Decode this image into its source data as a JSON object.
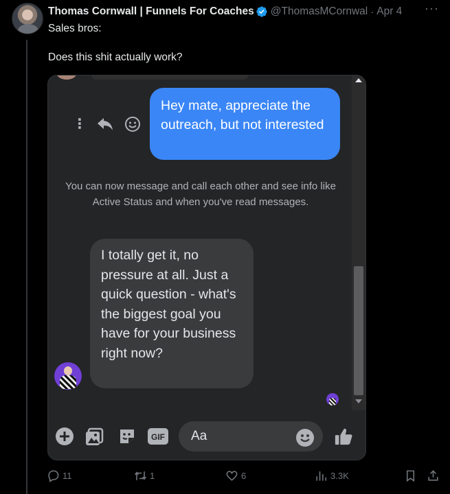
{
  "tweet": {
    "author_name": "Thomas Cornwall | Funnels For Coaches",
    "handle": "@ThomasMCornwal",
    "separator": "·",
    "date": "Apr 4",
    "more_label": "···",
    "text_line1": "Sales bros:",
    "text_line2": "Does this shit actually work?"
  },
  "chat": {
    "outgoing_message": "Hey mate, appreciate the outreach, but not interested",
    "system_notice": "You can now message and call each other and see info like Active Status and when you've read messages.",
    "incoming_message": "I totally get it, no pressure at all. Just a quick question - what's the biggest goal you have for your business right now?",
    "action_dots": "⋮",
    "composer": {
      "placeholder": "Aa",
      "gif_label": "GIF"
    },
    "colors": {
      "outgoing_bubble": "#3a86f6",
      "incoming_bubble": "#3a3b3c",
      "accent_icon": "#b0b3b8"
    }
  },
  "actions": {
    "replies": "11",
    "reposts": "1",
    "likes": "6",
    "views": "3.3K"
  }
}
